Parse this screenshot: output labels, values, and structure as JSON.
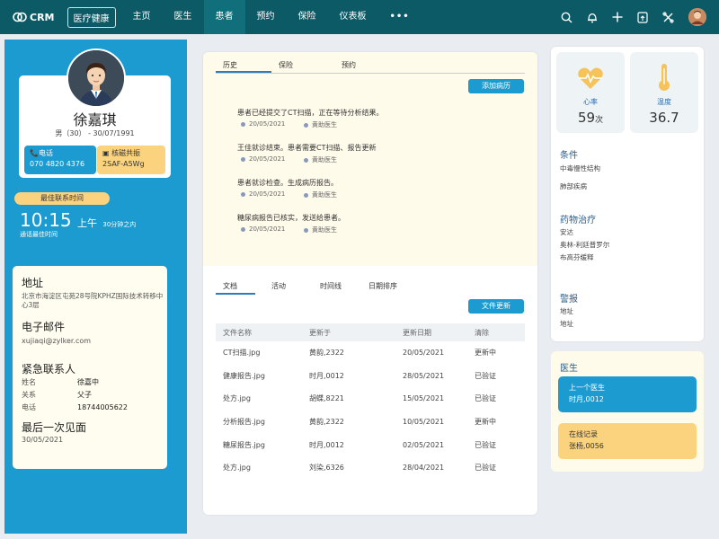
{
  "nav": {
    "logo": "CRM",
    "module": "医疗健康",
    "tabs": [
      "主页",
      "医生",
      "患者",
      "预约",
      "保险",
      "仪表板",
      "•••"
    ],
    "active_tab": 2
  },
  "profile": {
    "name": "徐嘉琪",
    "meta": "男（30） - 30/07/1991",
    "phone_label": "电话",
    "phone": "070 4820 4376",
    "mri_label": "核磁共振",
    "mri_id": "2SAF-A5Wg"
  },
  "contact_time": {
    "badge": "最佳联系时间",
    "time": "10:15",
    "ampm": "上午",
    "relative": "30分钟之内",
    "sub": "通话最佳时间"
  },
  "info": {
    "address_title": "地址",
    "address": "北京市海淀区屯苑28号院KPHZ国际技术转移中心3层",
    "email_title": "电子邮件",
    "email": "xujiaqi@zylker.com",
    "emergency_title": "紧急联系人",
    "emergency": [
      {
        "k": "姓名",
        "v": "徐嘉中"
      },
      {
        "k": "关系",
        "v": "父子"
      },
      {
        "k": "电话",
        "v": "18744005622"
      }
    ],
    "last_seen_title": "最后一次见面",
    "last_seen": "30/05/2021"
  },
  "history": {
    "tabs": [
      "历史",
      "保险",
      "预约"
    ],
    "add_button": "添加病历",
    "items": [
      {
        "title": "患者已经提交了CT扫描，正在等待分析结果。",
        "date": "20/05/2021",
        "who": "黄助医生"
      },
      {
        "title": "王佳就诊结束。患者需要CT扫描、报告更新",
        "date": "20/05/2021",
        "who": "黄助医生"
      },
      {
        "title": "患者就诊检查。生成病历报告。",
        "date": "20/05/2021",
        "who": "黄助医生"
      },
      {
        "title": "糖尿病报告已核实，发送给患者。",
        "date": "20/05/2021",
        "who": "黄助医生"
      }
    ]
  },
  "docs": {
    "tabs": [
      "文档",
      "活动",
      "时间线",
      "日期排序"
    ],
    "update_button": "文件更新",
    "headers": [
      "文件名称",
      "更新于",
      "更新日期",
      "清除"
    ],
    "rows": [
      [
        "CT扫描.jpg",
        "黄韵,2322",
        "20/05/2021",
        "更新中"
      ],
      [
        "健康报告.jpg",
        "时月,0012",
        "28/05/2021",
        "已验证"
      ],
      [
        "处方.jpg",
        "胡蝶,8221",
        "15/05/2021",
        "已验证"
      ],
      [
        "分析报告.jpg",
        "黄韵,2322",
        "10/05/2021",
        "更新中"
      ],
      [
        "糖尿报告.jpg",
        "时月,0012",
        "02/05/2021",
        "已验证"
      ],
      [
        "处方.jpg",
        "刘染,6326",
        "28/04/2021",
        "已验证"
      ]
    ]
  },
  "vitals": {
    "heart_label": "心率",
    "heart_value": "59",
    "heart_unit": "次",
    "temp_label": "温度",
    "temp_value": "36.7"
  },
  "conditions": {
    "title": "条件",
    "items": [
      "中毒慢性结构",
      "肺部疾病"
    ]
  },
  "medication": {
    "title": "药物治疗",
    "items": [
      "安达",
      "奥林-利廷普罗尔",
      "布高芬缓释"
    ]
  },
  "alerts": {
    "title": "警报",
    "items": [
      "地址",
      "地址"
    ]
  },
  "doctor": {
    "title": "医生",
    "prev_label": "上一个医生",
    "prev_name": "时月,0012",
    "online_label": "在线记录",
    "online_name": "张杨,0056"
  },
  "colors": {
    "nav": "#0c5a66",
    "primary": "#1b9bcf",
    "accent": "#fbd37f",
    "cream": "#fffbea"
  }
}
